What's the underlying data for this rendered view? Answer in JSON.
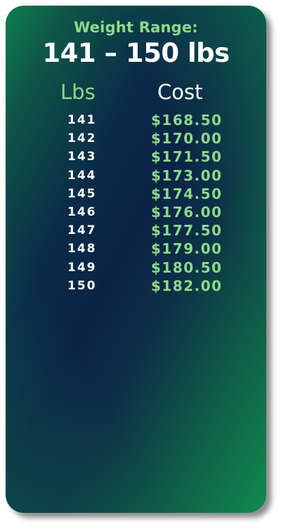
{
  "header": {
    "label": "Weight Range:",
    "range": "141 – 150 lbs"
  },
  "columns": {
    "lbs": "Lbs",
    "cost": "Cost"
  },
  "rows": [
    {
      "lbs": "141",
      "cost": "$168.50"
    },
    {
      "lbs": "142",
      "cost": "$170.00"
    },
    {
      "lbs": "143",
      "cost": "$171.50"
    },
    {
      "lbs": "144",
      "cost": "$173.00"
    },
    {
      "lbs": "145",
      "cost": "$174.50"
    },
    {
      "lbs": "146",
      "cost": "$176.00"
    },
    {
      "lbs": "147",
      "cost": "$177.50"
    },
    {
      "lbs": "148",
      "cost": "$179.00"
    },
    {
      "lbs": "149",
      "cost": "$180.50"
    },
    {
      "lbs": "150",
      "cost": "$182.00"
    }
  ],
  "colors": {
    "accent_green": "#8ed98a",
    "text_white": "#ffffff",
    "gradient_dark": "#0a2a48",
    "gradient_green": "#108a4e"
  }
}
